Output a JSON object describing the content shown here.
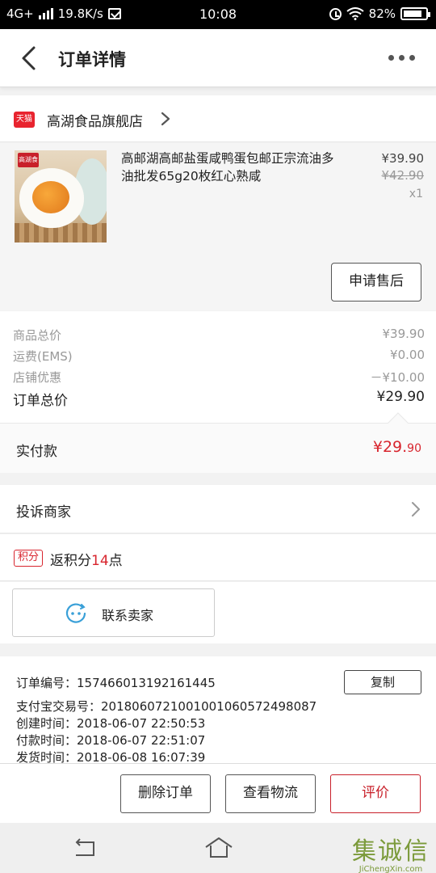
{
  "status_bar": {
    "network": "4G+",
    "speed": "19.8K/s",
    "time": "10:08",
    "battery": "82%"
  },
  "nav": {
    "title": "订单详情"
  },
  "shop": {
    "badge": "天猫",
    "name": "高湖食品旗舰店"
  },
  "product": {
    "image_logo": "高湖食",
    "title": "高邮湖高邮盐蛋咸鸭蛋包邮正宗流油多油批发65g20枚红心熟咸",
    "price": "¥39.90",
    "original_price": "¥42.90",
    "quantity": "x1",
    "after_sale_label": "申请售后"
  },
  "summary": {
    "rows": [
      {
        "label": "商品总价",
        "value": "¥39.90"
      },
      {
        "label": "运费(EMS)",
        "value": "¥0.00"
      },
      {
        "label": "店铺优惠",
        "value": "－¥10.00"
      }
    ],
    "total_label": "订单总价",
    "total_value": "¥29.90"
  },
  "paid": {
    "label": "实付款",
    "amount_main": "¥29.",
    "amount_dec": "90"
  },
  "complain": {
    "label": "投诉商家"
  },
  "points": {
    "badge": "积分",
    "prefix": "返积分",
    "num": "14",
    "suffix": "点"
  },
  "contact": {
    "label": "联系卖家"
  },
  "order_info": {
    "lines": [
      "订单编号：157466013192161445",
      "支付宝交易号：2018060721001001060572498087",
      "创建时间：2018-06-07 22:50:53",
      "付款时间：2018-06-07 22:51:07",
      "发货时间：2018-06-08 16:07:39"
    ],
    "copy_label": "复制"
  },
  "actions": {
    "delete_label": "删除订单",
    "logistics_label": "查看物流",
    "review_label": "评价"
  },
  "watermark": {
    "main": "集诚信",
    "sub": "JiChengXin.com"
  },
  "colors": {
    "accent_red": "#d8252e",
    "tmall_red": "#e8242f",
    "background": "#f2f2f2"
  }
}
